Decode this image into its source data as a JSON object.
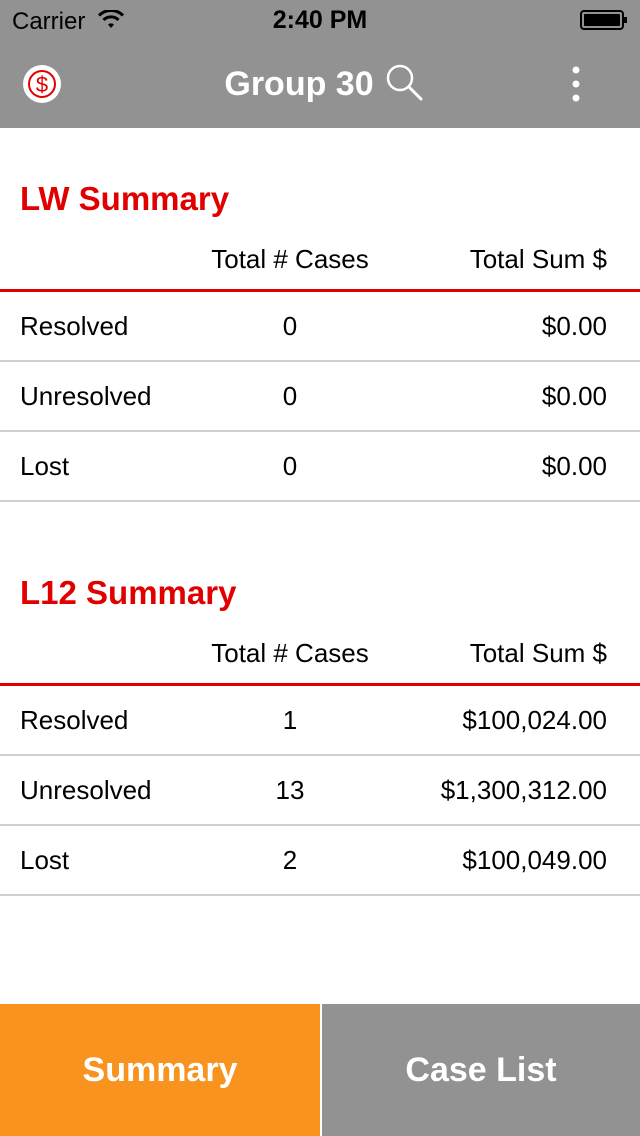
{
  "status_bar": {
    "carrier": "Carrier",
    "time": "2:40 PM"
  },
  "nav": {
    "title": "Group 30",
    "logo_icon": "dollar-coin-icon",
    "search_icon": "search-icon",
    "menu_icon": "more-vertical-icon"
  },
  "lw_summary": {
    "title": "LW Summary",
    "header_cases": "Total # Cases",
    "header_sum": "Total Sum $",
    "rows": [
      {
        "label": "Resolved",
        "count": "0",
        "sum": "$0.00"
      },
      {
        "label": "Unresolved",
        "count": "0",
        "sum": "$0.00"
      },
      {
        "label": "Lost",
        "count": "0",
        "sum": "$0.00"
      }
    ]
  },
  "l12_summary": {
    "title": "L12 Summary",
    "header_cases": "Total # Cases",
    "header_sum": "Total Sum $",
    "rows": [
      {
        "label": "Resolved",
        "count": "1",
        "sum": "$100,024.00"
      },
      {
        "label": "Unresolved",
        "count": "13",
        "sum": "$1,300,312.00"
      },
      {
        "label": "Lost",
        "count": "2",
        "sum": "$100,049.00"
      }
    ]
  },
  "tabs": {
    "summary": "Summary",
    "case_list": "Case List",
    "active": "summary"
  },
  "colors": {
    "accent_red": "#e10000",
    "nav_gray": "#929292",
    "active_tab_orange": "#f7931e"
  }
}
